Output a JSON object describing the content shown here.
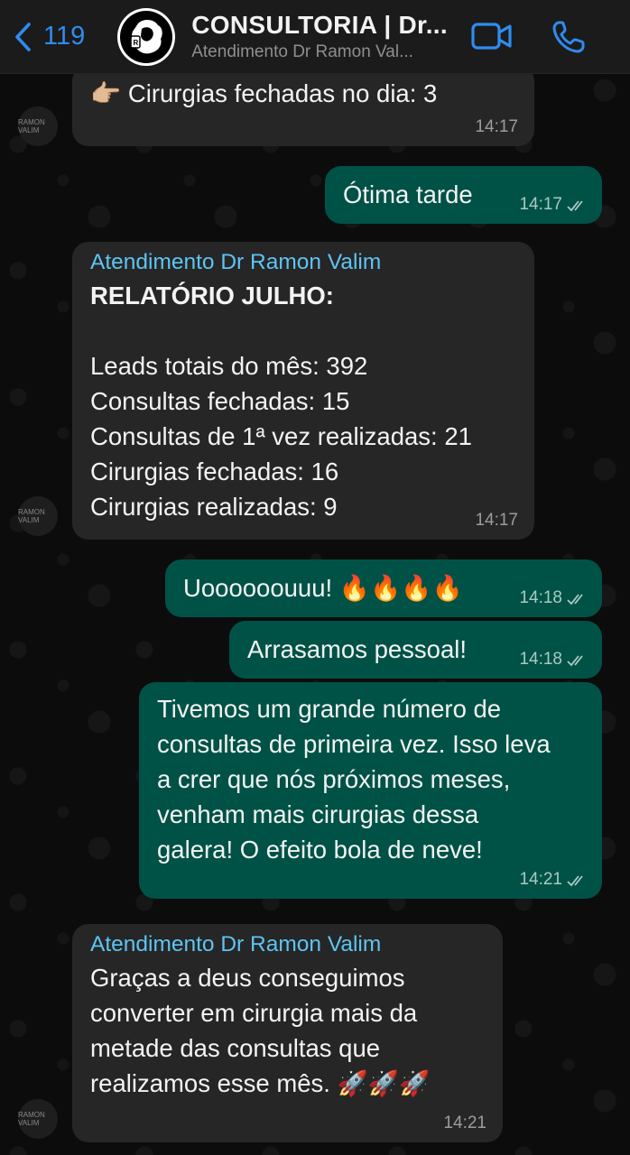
{
  "header": {
    "back_count": "119",
    "title": "CONSULTORIA | Dr...",
    "subtitle": "Atendimento Dr Ramon Val..."
  },
  "messages": [
    {
      "text": "👉🏼 Cirurgias fechadas no dia: 3",
      "time": "14:17"
    },
    {
      "text": "Ótima tarde",
      "time": "14:17"
    },
    {
      "sender": "Atendimento Dr Ramon Valim",
      "heading": "RELATÓRIO JULHO:",
      "lines": [
        "Leads totais do mês: 392",
        "Consultas fechadas: 15",
        "Consultas de 1ª vez realizadas: 21",
        "Cirurgias fechadas: 16",
        "Cirurgias realizadas: 9"
      ],
      "time": "14:17"
    },
    {
      "text": "Uoooooouuu! 🔥🔥🔥🔥",
      "time": "14:18"
    },
    {
      "text": "Arrasamos pessoal!",
      "time": "14:18"
    },
    {
      "lines": [
        "Tivemos um grande número de",
        "consultas de primeira vez. Isso leva",
        "a crer que nós próximos meses,",
        "venham mais cirurgias dessa",
        "galera! O efeito bola de neve!"
      ],
      "time": "14:21"
    },
    {
      "sender": "Atendimento Dr Ramon Valim",
      "lines": [
        "Graças a deus conseguimos",
        "converter em cirurgia mais da",
        "metade das consultas que",
        "realizamos esse mês. 🚀🚀🚀"
      ],
      "time": "14:21"
    }
  ],
  "avatar_label": "RAMON VALIM",
  "colors": {
    "incoming_bubble": "#262626",
    "outgoing_bubble": "#005246",
    "sender_name": "#5ec4f3",
    "accent": "#2f8cf0"
  }
}
